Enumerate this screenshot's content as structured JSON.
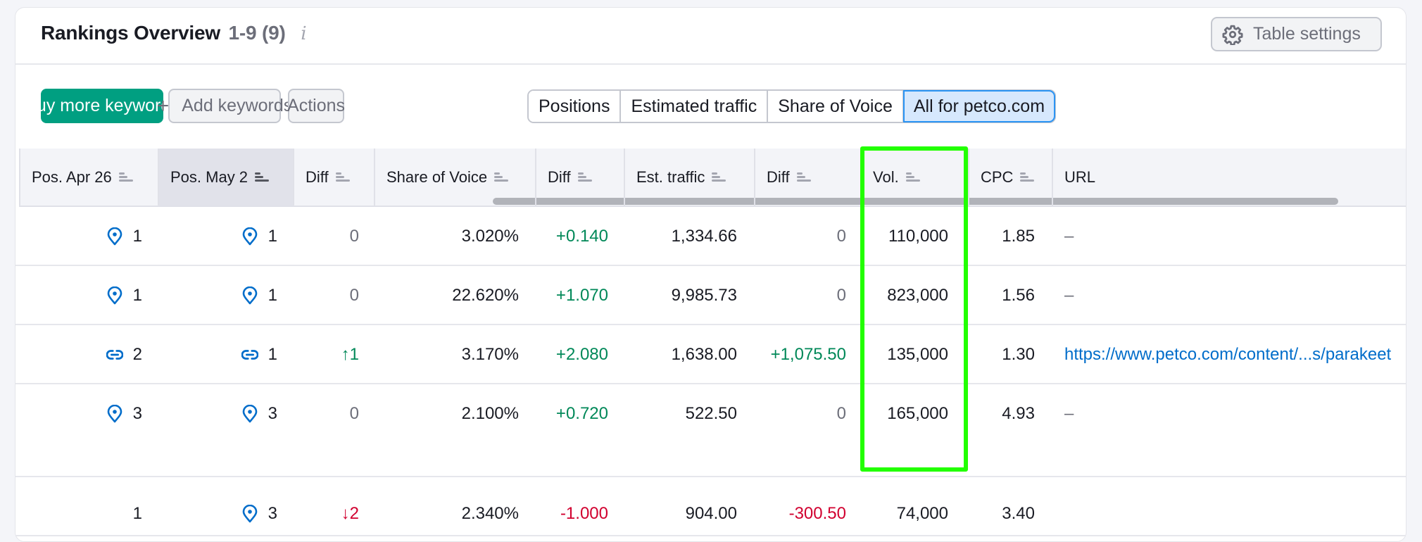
{
  "header": {
    "title": "Rankings Overview",
    "count": "1-9 (9)",
    "info_icon": "i",
    "table_settings_label": "Table settings"
  },
  "toolbar": {
    "buy_label": "Buy more keywords",
    "add_label": "Add keywords",
    "add_icon": "+",
    "actions_label": "Actions",
    "segments": [
      {
        "label": "Positions",
        "active": false
      },
      {
        "label": "Estimated traffic",
        "active": false
      },
      {
        "label": "Share of Voice",
        "active": false
      },
      {
        "label": "All for petco.com",
        "active": true
      }
    ]
  },
  "table": {
    "columns": [
      {
        "label": "Pos. Apr 26",
        "sorted": false
      },
      {
        "label": "Pos. May 2",
        "sorted": true
      },
      {
        "label": "Diff",
        "sorted": false
      },
      {
        "label": "Share of Voice",
        "sorted": false
      },
      {
        "label": "Diff",
        "sorted": false
      },
      {
        "label": "Est. traffic",
        "sorted": false
      },
      {
        "label": "Diff",
        "sorted": false
      },
      {
        "label": "Vol.",
        "sorted": false
      },
      {
        "label": "CPC",
        "sorted": false
      },
      {
        "label": "URL",
        "sorted": false
      }
    ],
    "rows": [
      {
        "pos_prev": "1",
        "pos_prev_icon": "pin-icon",
        "pos_curr": "1",
        "pos_curr_icon": "pin-icon",
        "pos_diff": "0",
        "pos_diff_tone": "muted",
        "sov": "3.020%",
        "sov_diff": "+0.140",
        "sov_diff_tone": "green",
        "traffic": "1,334.66",
        "traffic_diff": "0",
        "traffic_diff_tone": "muted",
        "vol": "110,000",
        "cpc": "1.85",
        "url": "–",
        "url_is_link": false
      },
      {
        "pos_prev": "1",
        "pos_prev_icon": "pin-icon",
        "pos_curr": "1",
        "pos_curr_icon": "pin-icon",
        "pos_diff": "0",
        "pos_diff_tone": "muted",
        "sov": "22.620%",
        "sov_diff": "+1.070",
        "sov_diff_tone": "green",
        "traffic": "9,985.73",
        "traffic_diff": "0",
        "traffic_diff_tone": "muted",
        "vol": "823,000",
        "cpc": "1.56",
        "url": "–",
        "url_is_link": false
      },
      {
        "pos_prev": "2",
        "pos_prev_icon": "link-icon",
        "pos_curr": "1",
        "pos_curr_icon": "link-icon",
        "pos_diff": "↑1",
        "pos_diff_tone": "green",
        "sov": "3.170%",
        "sov_diff": "+2.080",
        "sov_diff_tone": "green",
        "traffic": "1,638.00",
        "traffic_diff": "+1,075.50",
        "traffic_diff_tone": "green",
        "vol": "135,000",
        "cpc": "1.30",
        "url": "https://www.petco.com/content/...s/parakeet",
        "url_is_link": true
      },
      {
        "pos_prev": "3",
        "pos_prev_icon": "pin-icon",
        "pos_curr": "3",
        "pos_curr_icon": "pin-icon",
        "pos_diff": "0",
        "pos_diff_tone": "muted",
        "sov": "2.100%",
        "sov_diff": "+0.720",
        "sov_diff_tone": "green",
        "traffic": "522.50",
        "traffic_diff": "0",
        "traffic_diff_tone": "muted",
        "vol": "165,000",
        "cpc": "4.93",
        "url": "–",
        "url_is_link": false
      },
      {
        "pos_prev": "1",
        "pos_prev_icon": "",
        "pos_curr": "3",
        "pos_curr_icon": "pin-icon",
        "pos_diff": "↓2",
        "pos_diff_tone": "red",
        "sov": "2.340%",
        "sov_diff": "-1.000",
        "sov_diff_tone": "red",
        "traffic": "904.00",
        "traffic_diff": "-300.50",
        "traffic_diff_tone": "red",
        "vol": "74,000",
        "cpc": "3.40",
        "url": "",
        "url_is_link": false
      }
    ]
  },
  "colors": {
    "primary_green": "#009f81",
    "positive": "#008858",
    "negative": "#d1002f",
    "link": "#006dca",
    "active_segment_bg": "#d6e8fd",
    "highlight_box": "#22ff00"
  }
}
